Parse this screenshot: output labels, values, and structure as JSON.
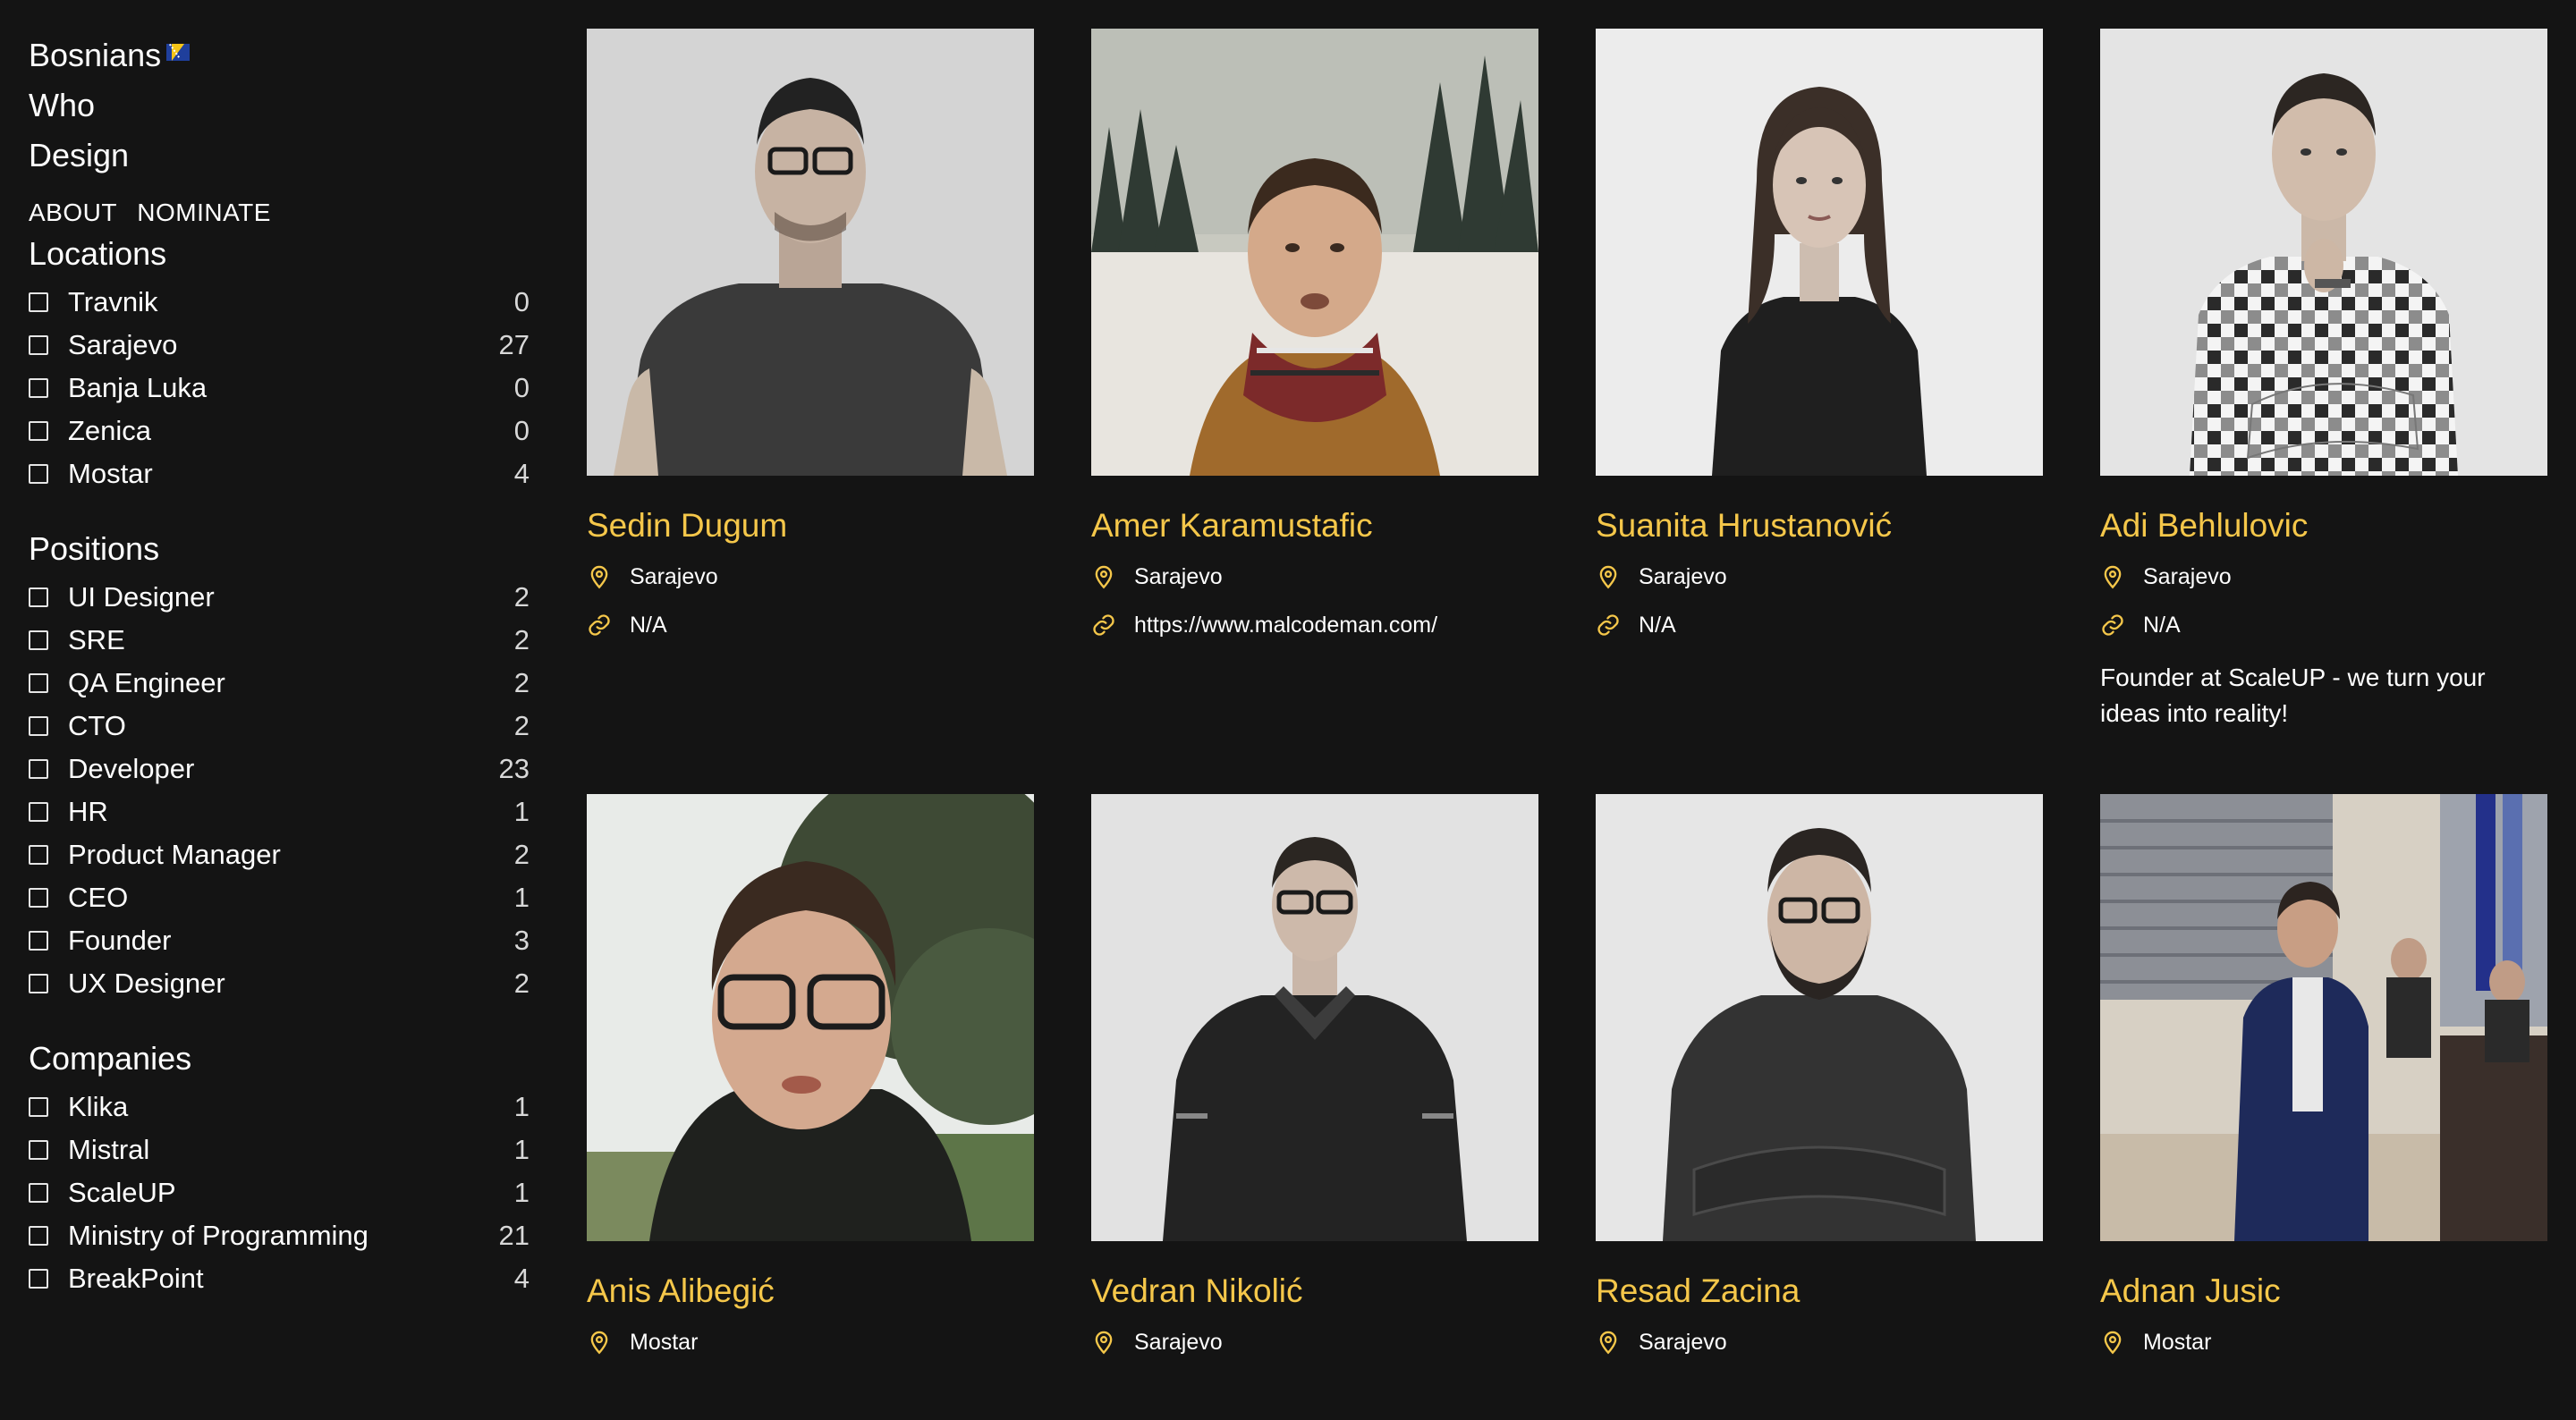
{
  "logo": {
    "line1": "Bosnians",
    "line2": "Who",
    "line3": "Design"
  },
  "nav": {
    "about": "ABOUT",
    "nominate": "NOMINATE"
  },
  "filters": {
    "locations": {
      "title": "Locations",
      "items": [
        {
          "label": "Travnik",
          "count": "0"
        },
        {
          "label": "Sarajevo",
          "count": "27"
        },
        {
          "label": "Banja Luka",
          "count": "0"
        },
        {
          "label": "Zenica",
          "count": "0"
        },
        {
          "label": "Mostar",
          "count": "4"
        }
      ]
    },
    "positions": {
      "title": "Positions",
      "items": [
        {
          "label": "UI Designer",
          "count": "2"
        },
        {
          "label": "SRE",
          "count": "2"
        },
        {
          "label": "QA Engineer",
          "count": "2"
        },
        {
          "label": "CTO",
          "count": "2"
        },
        {
          "label": "Developer",
          "count": "23"
        },
        {
          "label": "HR",
          "count": "1"
        },
        {
          "label": "Product Manager",
          "count": "2"
        },
        {
          "label": "CEO",
          "count": "1"
        },
        {
          "label": "Founder",
          "count": "3"
        },
        {
          "label": "UX Designer",
          "count": "2"
        }
      ]
    },
    "companies": {
      "title": "Companies",
      "items": [
        {
          "label": "Klika",
          "count": "1"
        },
        {
          "label": "Mistral",
          "count": "1"
        },
        {
          "label": "ScaleUP",
          "count": "1"
        },
        {
          "label": "Ministry of Programming",
          "count": "21"
        },
        {
          "label": "BreakPoint",
          "count": "4"
        }
      ]
    }
  },
  "people": [
    {
      "name": "Sedin Dugum",
      "location": "Sarajevo",
      "link": "N/A",
      "bio": ""
    },
    {
      "name": "Amer Karamustafic",
      "location": "Sarajevo",
      "link": "https://www.malcodeman.com/",
      "bio": ""
    },
    {
      "name": "Suanita Hrustanović",
      "location": "Sarajevo",
      "link": "N/A",
      "bio": ""
    },
    {
      "name": "Adi Behlulovic",
      "location": "Sarajevo",
      "link": "N/A",
      "bio": "Founder at ScaleUP - we turn your ideas into reality!"
    },
    {
      "name": "Anis Alibegić",
      "location": "Mostar",
      "link": "",
      "bio": ""
    },
    {
      "name": "Vedran Nikolić",
      "location": "Sarajevo",
      "link": "",
      "bio": ""
    },
    {
      "name": "Resad Zacina",
      "location": "Sarajevo",
      "link": "",
      "bio": ""
    },
    {
      "name": "Adnan Jusic",
      "location": "Mostar",
      "link": "",
      "bio": ""
    }
  ],
  "colors": {
    "background": "#141414",
    "accent": "#f5c74a",
    "text": "#ffffff"
  },
  "icons": {
    "location": "map-pin-icon",
    "link": "link-icon",
    "checkbox": "checkbox-icon",
    "flag": "bosnia-flag-icon"
  }
}
